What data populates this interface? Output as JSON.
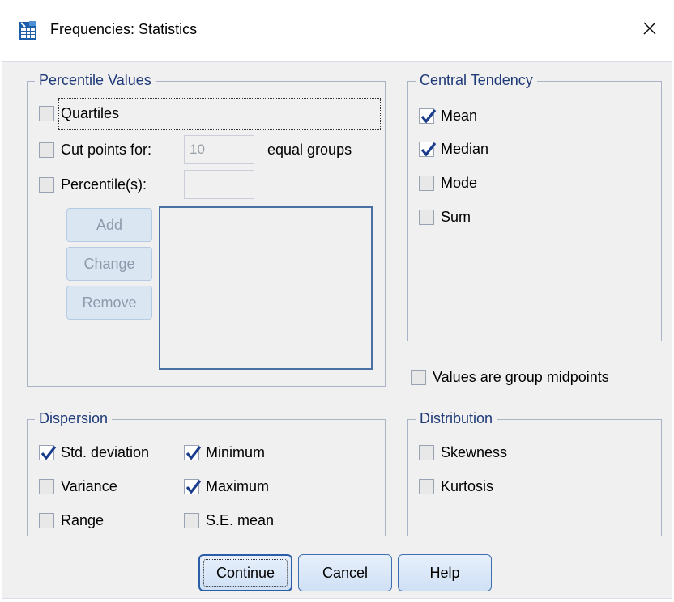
{
  "window": {
    "title": "Frequencies: Statistics",
    "close_glyph": "✕",
    "icon": "spss-table-icon"
  },
  "percentile_values": {
    "legend": "Percentile Values",
    "quartiles": {
      "label": "Quartiles",
      "checked": false
    },
    "cut_points": {
      "label": "Cut points for:",
      "value": "10",
      "suffix": "equal groups",
      "checked": false
    },
    "percentiles": {
      "label": "Percentile(s):",
      "value": "",
      "checked": false
    },
    "buttons": {
      "add": "Add",
      "change": "Change",
      "remove": "Remove"
    }
  },
  "central_tendency": {
    "legend": "Central Tendency",
    "items": [
      {
        "label": "Mean",
        "checked": true
      },
      {
        "label": "Median",
        "checked": true
      },
      {
        "label": "Mode",
        "checked": false
      },
      {
        "label": "Sum",
        "checked": false
      }
    ]
  },
  "group_midpoints": {
    "label": "Values are group midpoints",
    "checked": false
  },
  "dispersion": {
    "legend": "Dispersion",
    "items": [
      {
        "label": "Std. deviation",
        "checked": true
      },
      {
        "label": "Variance",
        "checked": false
      },
      {
        "label": "Range",
        "checked": false
      },
      {
        "label": "Minimum",
        "checked": true
      },
      {
        "label": "Maximum",
        "checked": true
      },
      {
        "label": "S.E. mean",
        "checked": false
      }
    ]
  },
  "distribution": {
    "legend": "Distribution",
    "items": [
      {
        "label": "Skewness",
        "checked": false
      },
      {
        "label": "Kurtosis",
        "checked": false
      }
    ]
  },
  "footer": {
    "continue": "Continue",
    "cancel": "Cancel",
    "help": "Help"
  },
  "colors": {
    "accent": "#1f3a78",
    "check": "#1a3c8c",
    "button_border": "#3e6fb0"
  }
}
